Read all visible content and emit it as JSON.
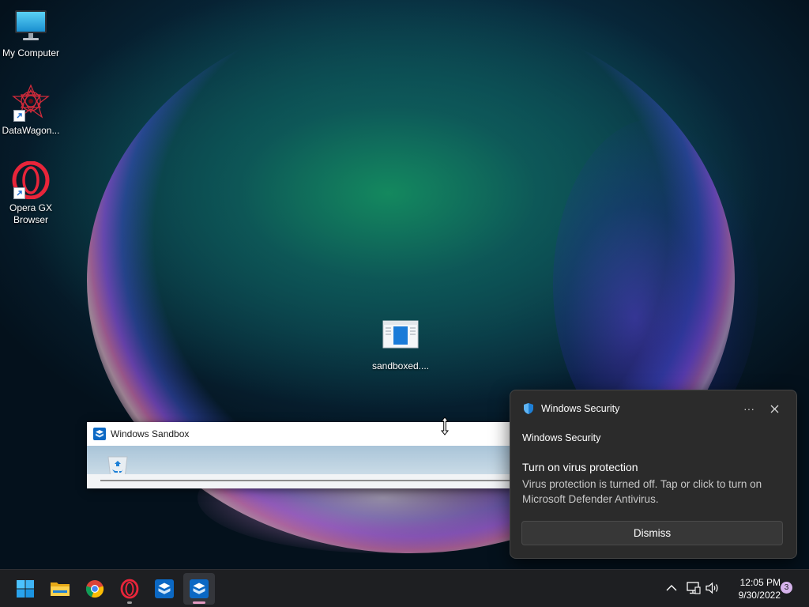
{
  "desktop": {
    "icons": [
      {
        "label": "My Computer",
        "icon": "monitor-icon"
      },
      {
        "label": "DataWagon...",
        "icon": "datawagon-icon"
      },
      {
        "label": "Opera GX Browser",
        "icon": "opera-gx-icon"
      },
      {
        "label": "sandboxed....",
        "icon": "sandbox-file-icon"
      }
    ]
  },
  "sandbox_window": {
    "title": "Windows Sandbox",
    "icon": "windows-sandbox-icon"
  },
  "toast": {
    "app_name": "Windows Security",
    "source": "Windows Security",
    "title": "Turn on virus protection",
    "body": "Virus protection is turned off. Tap or click to turn on Microsoft Defender Antivirus.",
    "more_label": "···",
    "close_label": "✕",
    "dismiss_label": "Dismiss"
  },
  "taskbar": {
    "apps": [
      {
        "name": "Start",
        "icon": "windows-start-icon"
      },
      {
        "name": "File Explorer",
        "icon": "folder-icon"
      },
      {
        "name": "Google Chrome",
        "icon": "chrome-icon"
      },
      {
        "name": "Opera GX",
        "icon": "opera-gx-icon"
      },
      {
        "name": "Windows Sandbox",
        "icon": "windows-sandbox-icon"
      },
      {
        "name": "Windows Sandbox (active)",
        "icon": "windows-sandbox-icon"
      }
    ],
    "tray": {
      "time": "12:05 PM",
      "date": "9/30/2022",
      "notification_count": "3"
    }
  },
  "colors": {
    "toast_bg": "#2b2b2b",
    "taskbar_bg": "#1e1f22",
    "accent": "#0067c0",
    "opera_red": "#e8253a",
    "badge": "#d6b3ec"
  }
}
